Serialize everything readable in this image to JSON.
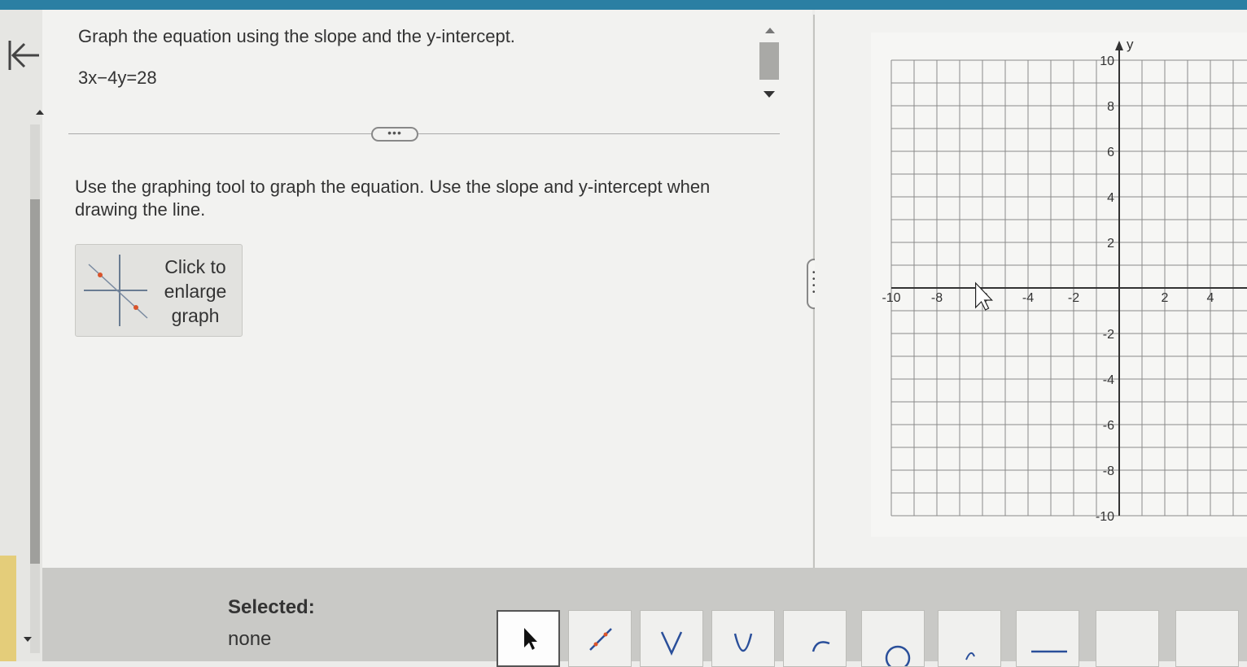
{
  "question": {
    "instruction": "Graph the equation using the slope and the y-intercept.",
    "equation": "3x−4y=28"
  },
  "expand_button": {
    "label": "•••"
  },
  "directions": "Use the graphing tool to graph the equation.  Use the slope and y-intercept when drawing the line.",
  "enlarge_button": {
    "label_lines": [
      "Click to",
      "enlarge",
      "graph"
    ]
  },
  "graph": {
    "axis_label_y": "y",
    "x_range": [
      -10,
      10
    ],
    "y_range": [
      -10,
      10
    ],
    "x_tick_labels": [
      "-10",
      "-8",
      "-6",
      "-4",
      "-2",
      "2",
      "4"
    ],
    "y_tick_labels": [
      "10",
      "8",
      "6",
      "4",
      "2",
      "-2",
      "-4",
      "-6",
      "-8",
      "-10"
    ],
    "grid": true
  },
  "toolbar": {
    "selected_label": "Selected:",
    "selected_value": "none",
    "tools": [
      {
        "name": "select-pointer-tool",
        "icon": "arrow-pointer-icon"
      },
      {
        "name": "line-tool",
        "icon": "line-icon"
      },
      {
        "name": "absolute-value-tool",
        "icon": "v-shape-icon"
      },
      {
        "name": "parabola-tool",
        "icon": "u-shape-icon"
      },
      {
        "name": "square-root-tool",
        "icon": "curve-icon"
      },
      {
        "name": "circle-tool",
        "icon": "circle-icon"
      },
      {
        "name": "cubic-tool",
        "icon": "cubic-icon"
      },
      {
        "name": "horizontal-line-tool",
        "icon": "dash-icon"
      },
      {
        "name": "tool-9",
        "icon": "blank-icon"
      },
      {
        "name": "tool-10",
        "icon": "blank-icon"
      }
    ]
  },
  "colors": {
    "top_bar": "#2b7fa3",
    "grid_line": "#8a8a8a",
    "enlarge_icon_red": "#d9542b"
  }
}
